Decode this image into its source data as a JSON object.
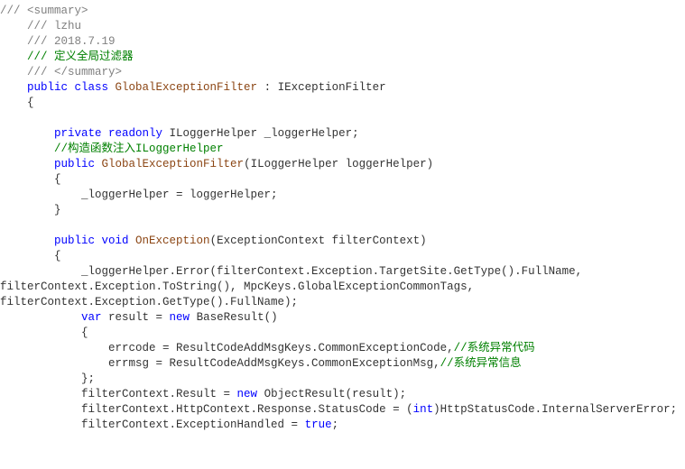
{
  "code": {
    "l1": "/// <summary>",
    "l2": "    /// lzhu",
    "l3": "    /// 2018.7.19",
    "l4": "    /// 定义全局过滤器",
    "l5": "    /// </summary>",
    "l6a": "    public",
    "l6b": " class",
    "l6c": " GlobalExceptionFilter",
    "l6d": " : IExceptionFilter",
    "l7": "    {",
    "l8": "",
    "l9a": "        private",
    "l9b": " readonly",
    "l9c": " ILoggerHelper _loggerHelper;",
    "l10a": "        //构造函数注入ILoggerHelper",
    "l11a": "        public",
    "l11b": " GlobalExceptionFilter",
    "l11c": "(ILoggerHelper loggerHelper)",
    "l12": "        {",
    "l13": "            _loggerHelper = loggerHelper;",
    "l14": "        }",
    "l15": "",
    "l16a": "        public",
    "l16b": " void",
    "l16c": " OnException",
    "l16d": "(ExceptionContext filterContext)",
    "l17": "        {",
    "l18": "            _loggerHelper.Error(filterContext.Exception.TargetSite.GetType().FullName, ",
    "l19": "filterContext.Exception.ToString(), MpcKeys.GlobalExceptionCommonTags, ",
    "l20": "filterContext.Exception.GetType().FullName);",
    "l21a": "            var",
    "l21b": " result = ",
    "l21c": "new",
    "l21d": " BaseResult()",
    "l22": "            {",
    "l23a": "                errcode = ResultCodeAddMsgKeys.CommonExceptionCode,",
    "l23b": "//系统异常代码",
    "l24a": "                errmsg = ResultCodeAddMsgKeys.CommonExceptionMsg,",
    "l24b": "//系统异常信息",
    "l25": "            };",
    "l26a": "            filterContext.Result = ",
    "l26b": "new",
    "l26c": " ObjectResult(result);",
    "l27a": "            filterContext.HttpContext.Response.StatusCode = (",
    "l27b": "int",
    "l27c": ")HttpStatusCode.InternalServerError;",
    "l28a": "            filterContext.ExceptionHandled = ",
    "l28b": "true",
    "l28c": ";"
  }
}
